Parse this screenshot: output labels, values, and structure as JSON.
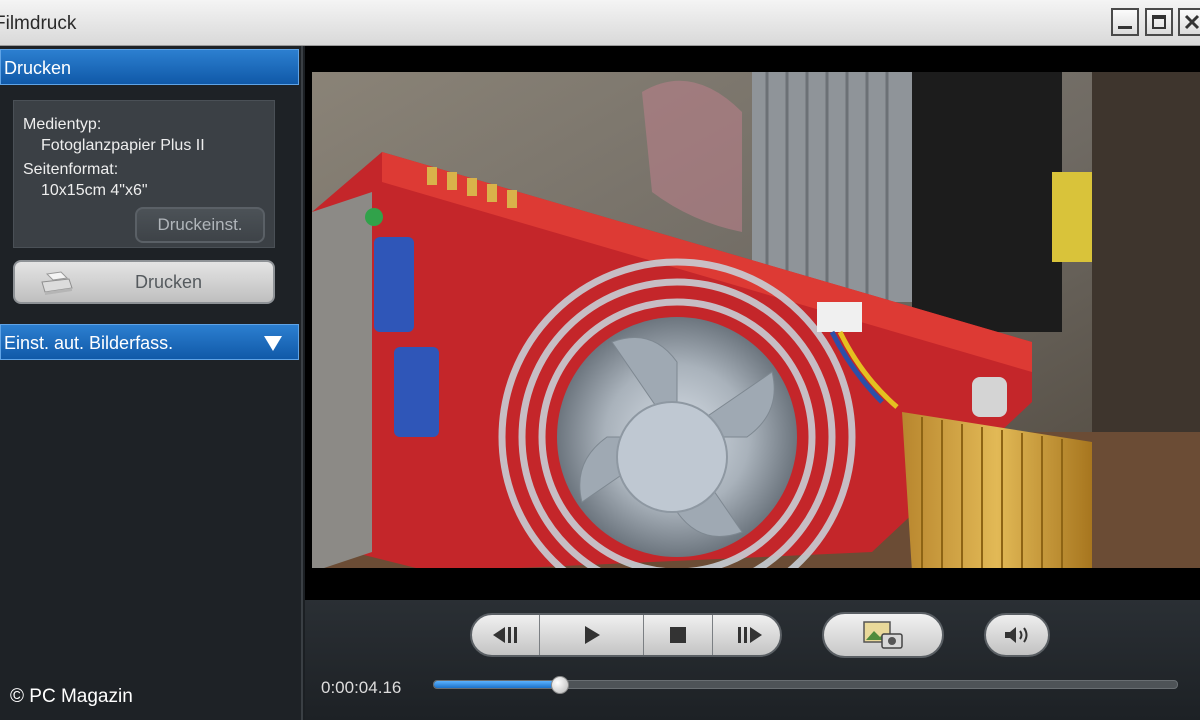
{
  "window": {
    "title": "Filmdruck"
  },
  "sidebar": {
    "print_section": {
      "label": "Drucken"
    },
    "info": {
      "media_label": "Medientyp:",
      "media_value": "Fotoglanzpapier Plus II",
      "page_label": "Seitenformat:",
      "page_value": "10x15cm 4\"x6\""
    },
    "settings_button": "Druckeinst.",
    "print_button": "Drucken",
    "auto_section": {
      "label": "Einst. aut. Bilderfass."
    }
  },
  "player": {
    "current_time": "0:00:04.16",
    "progress": 0.17
  },
  "footer": {
    "copyright": "© PC Magazin"
  },
  "icons": {
    "minimize": "minimize-icon",
    "maximize": "maximize-icon",
    "close": "close-icon",
    "printer": "printer-icon",
    "expand": "triangle-down-icon",
    "prev_frame": "step-back-icon",
    "play": "play-icon",
    "stop": "stop-icon",
    "next_frame": "step-forward-icon",
    "capture": "photo-capture-icon",
    "volume": "speaker-icon"
  },
  "colors": {
    "accent": "#1a6cc0",
    "panel": "#3b4045",
    "background": "#1e2226"
  }
}
